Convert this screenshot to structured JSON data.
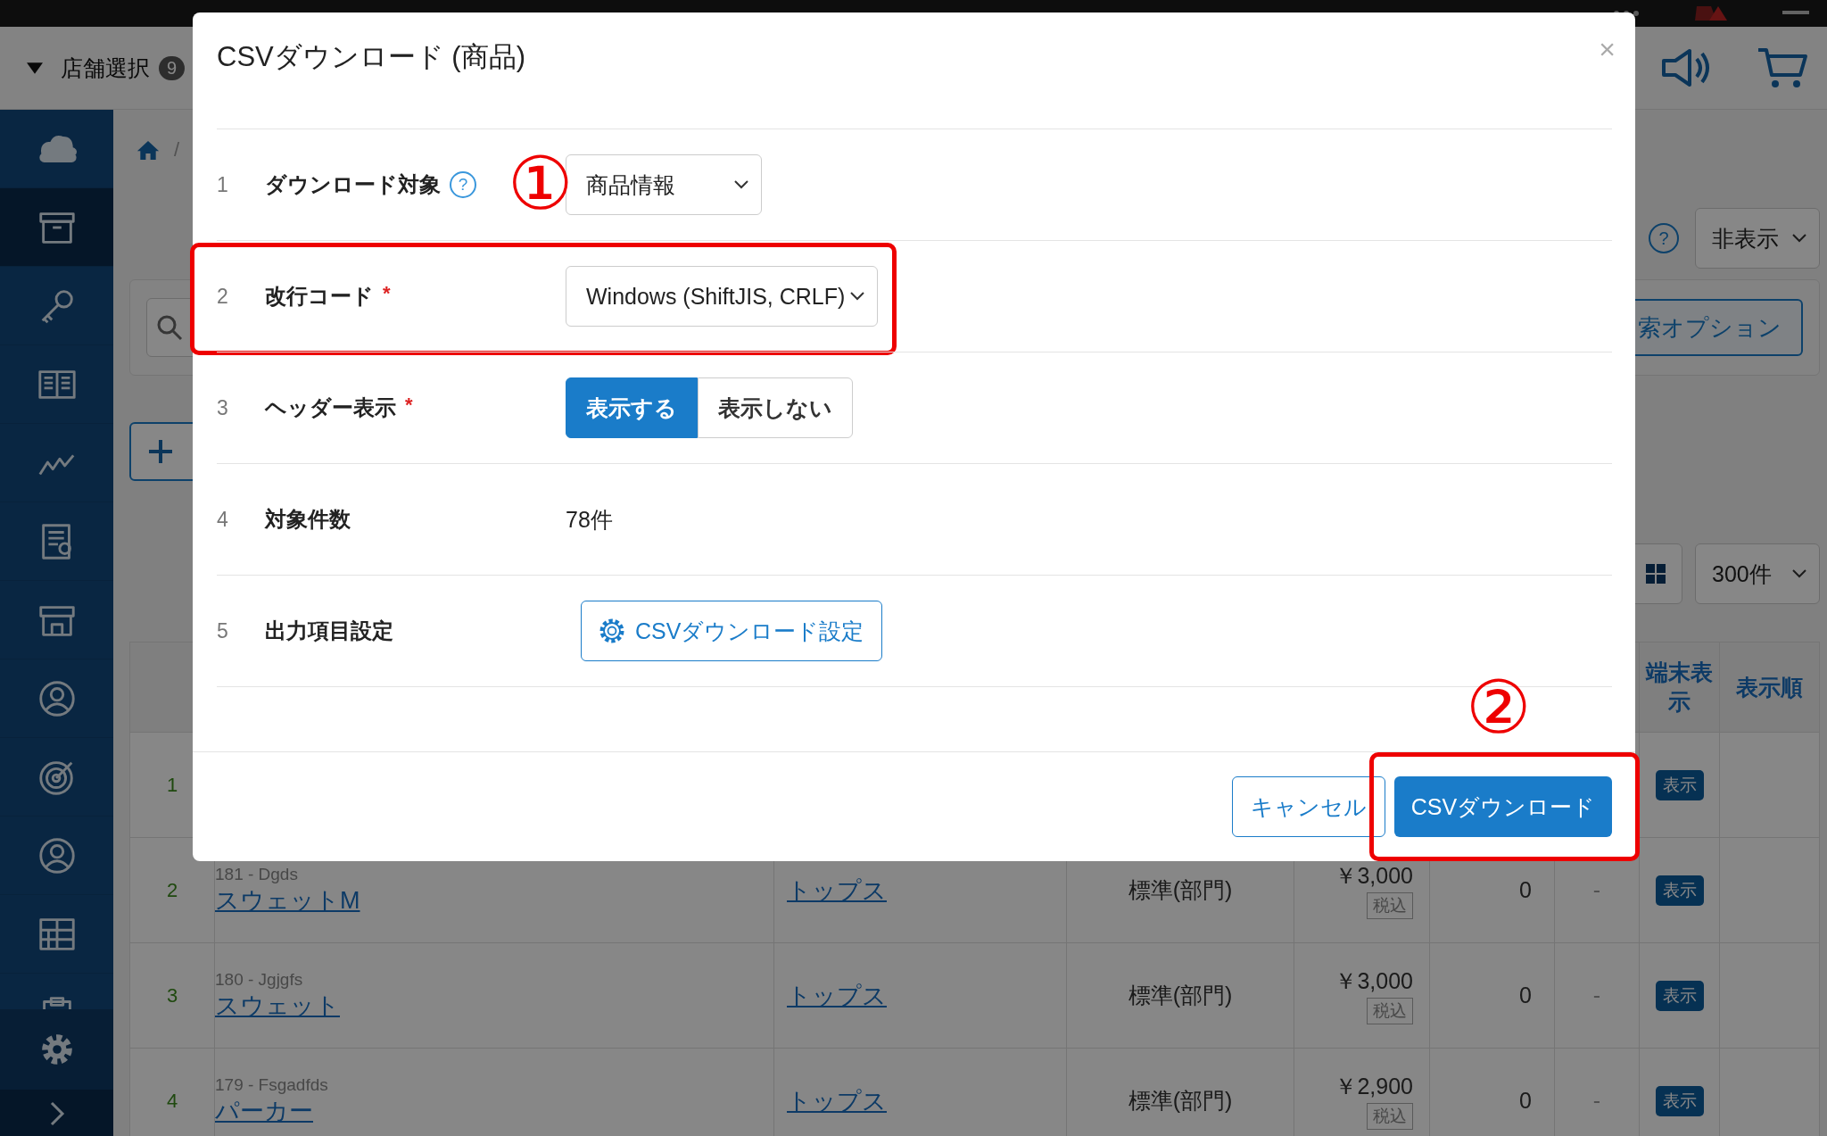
{
  "header": {
    "store_select": "店舗選択",
    "store_count": "9"
  },
  "sidebar": {
    "items": [
      {
        "selected": false
      },
      {
        "selected": true
      },
      {
        "selected": false
      },
      {
        "selected": false
      },
      {
        "selected": false
      },
      {
        "selected": false
      },
      {
        "selected": false
      },
      {
        "selected": false
      },
      {
        "selected": false
      },
      {
        "selected": false
      },
      {
        "selected": false
      },
      {
        "selected": false
      }
    ]
  },
  "breadcrumb": {
    "separator": "/"
  },
  "toolbar": {
    "help": "?",
    "visibility_select": "非表示",
    "search_options_button": "索オプション",
    "page_size_select": "300件"
  },
  "table": {
    "columns": [
      "端末表示",
      "表示順"
    ],
    "rows": [
      {
        "no": "1",
        "display_badge": "表示"
      },
      {
        "no": "2",
        "code": "181 - Dgds",
        "name": "スウェットM",
        "category": "トップス",
        "type": "標準(部門)",
        "price": "￥3,000",
        "tax": "税込",
        "stock": "0",
        "column_7": "-",
        "display_badge": "表示"
      },
      {
        "no": "3",
        "code": "180 - Jgjgfs",
        "name": "スウェット",
        "category": "トップス",
        "type": "標準(部門)",
        "price": "￥3,000",
        "tax": "税込",
        "stock": "0",
        "column_7": "-",
        "display_badge": "表示"
      },
      {
        "no": "4",
        "code": "179 - Fsgadfds",
        "name": "パーカー",
        "category": "トップス",
        "type": "標準(部門)",
        "price": "￥2,900",
        "tax": "税込",
        "stock": "0",
        "column_7": "-",
        "display_badge": "表示"
      }
    ]
  },
  "dialog": {
    "title": "CSVダウンロード (商品)",
    "close": "×",
    "rows": [
      {
        "no": "1",
        "label": "ダウンロード対象",
        "help": "?",
        "kind": "select",
        "value": "商品情報",
        "callout": "①"
      },
      {
        "no": "2",
        "label": "改行コード",
        "required_mark": "*",
        "kind": "select",
        "value": "Windows (ShiftJIS, CRLF)",
        "highlighted": true
      },
      {
        "no": "3",
        "label": "ヘッダー表示",
        "required_mark": "*",
        "kind": "toggle",
        "options": [
          {
            "label": "表示する",
            "selected": true
          },
          {
            "label": "表示しない",
            "selected": false
          }
        ]
      },
      {
        "no": "4",
        "label": "対象件数",
        "kind": "text",
        "value": "78件"
      },
      {
        "no": "5",
        "label": "出力項目設定",
        "kind": "button",
        "value": "CSVダウンロード設定"
      }
    ],
    "cancel": "キャンセル",
    "submit": "CSVダウンロード",
    "submit_callout": "②",
    "submit_highlighted": true
  }
}
